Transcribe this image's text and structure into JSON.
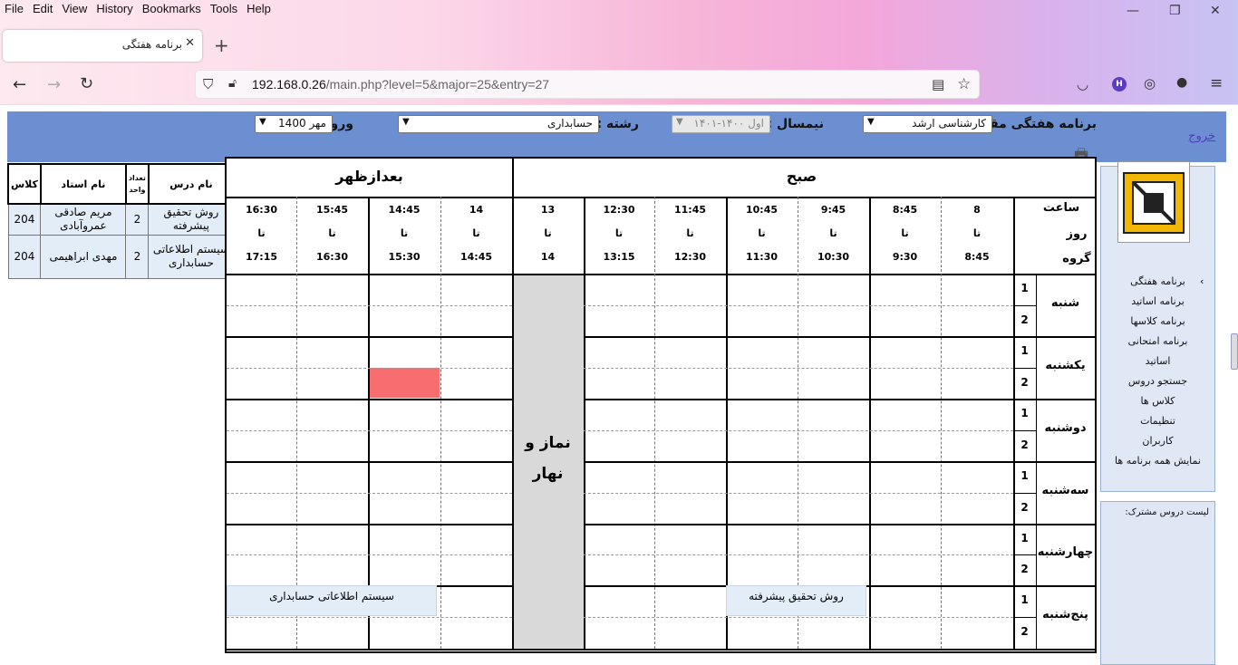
{
  "browser": {
    "menu": [
      "File",
      "Edit",
      "View",
      "History",
      "Bookmarks",
      "Tools",
      "Help"
    ],
    "tab_title": "برنامه هفتگی",
    "url_host": "192.168.0.26",
    "url_path": "/main.php?level=5&major=25&entry=27"
  },
  "header": {
    "level_label": "برنامه هفتگی مقطع :",
    "level_value": "کارشناسی ارشد",
    "semester_label": "نیمسال :",
    "semester_value": "اول ۱۴۰۰-۱۴۰۱",
    "major_label": "رشته :",
    "major_value": "حسابداری",
    "entry_label": "ورودی :",
    "entry_value": "مهر 1400",
    "logout": "خروج"
  },
  "sidebar": {
    "items": [
      "برنامه هفتگی",
      "برنامه اساتید",
      "برنامه کلاسها",
      "برنامه امتحانی",
      "اساتید",
      "جستجو دروس",
      "کلاس ها",
      "تنظیمات",
      "کاربران",
      "نمایش همه برنامه ها"
    ],
    "shared_title": "لیست دروس مشترک:"
  },
  "schedule": {
    "morning_label": "صبح",
    "afternoon_label": "بعدازظهر",
    "corner": {
      "hour": "ساعت",
      "day": "روز",
      "group": "گروه"
    },
    "to": "تا",
    "slots_morning": [
      {
        "from": "8",
        "to": "8:45"
      },
      {
        "from": "8:45",
        "to": "9:30"
      },
      {
        "from": "9:45",
        "to": "10:30"
      },
      {
        "from": "10:45",
        "to": "11:30"
      },
      {
        "from": "11:45",
        "to": "12:30"
      },
      {
        "from": "12:30",
        "to": "13:15"
      }
    ],
    "lunch_slot": {
      "from": "13",
      "to": "14"
    },
    "slots_afternoon": [
      {
        "from": "14",
        "to": "14:45"
      },
      {
        "from": "14:45",
        "to": "15:30"
      },
      {
        "from": "15:45",
        "to": "16:30"
      },
      {
        "from": "16:30",
        "to": "17:15"
      }
    ],
    "days": [
      "شنبه",
      "یکشنبه",
      "دوشنبه",
      "سه‌شنبه",
      "چهارشنبه",
      "پنج‌شنبه"
    ],
    "groups": [
      "1",
      "2"
    ],
    "lunch_text": "نماز و نهار",
    "events": [
      {
        "day": "پنج‌شنبه",
        "title": "روش تحقیق پیشرفته"
      },
      {
        "day": "پنج‌شنبه",
        "title": "سیستم اطلاعاتی حسابداری"
      }
    ]
  },
  "course_table": {
    "headers": [
      "نام درس",
      "تعداد واحد",
      "نام استاد",
      "کلاس"
    ],
    "rows": [
      {
        "course": "روش تحقیق پیشرفته",
        "units": "2",
        "teacher": "مریم صادقی عمروآبادی",
        "room": "204"
      },
      {
        "course": "سیستم اطلاعاتی حسابداری",
        "units": "2",
        "teacher": "مهدی ابراهیمی",
        "room": "204"
      }
    ]
  },
  "colors": {
    "header_bg": "#6b8fd0",
    "lunch_bg": "#d9d9d9",
    "highlight": "#f86e6e",
    "event_bg": "#e2edf8"
  }
}
